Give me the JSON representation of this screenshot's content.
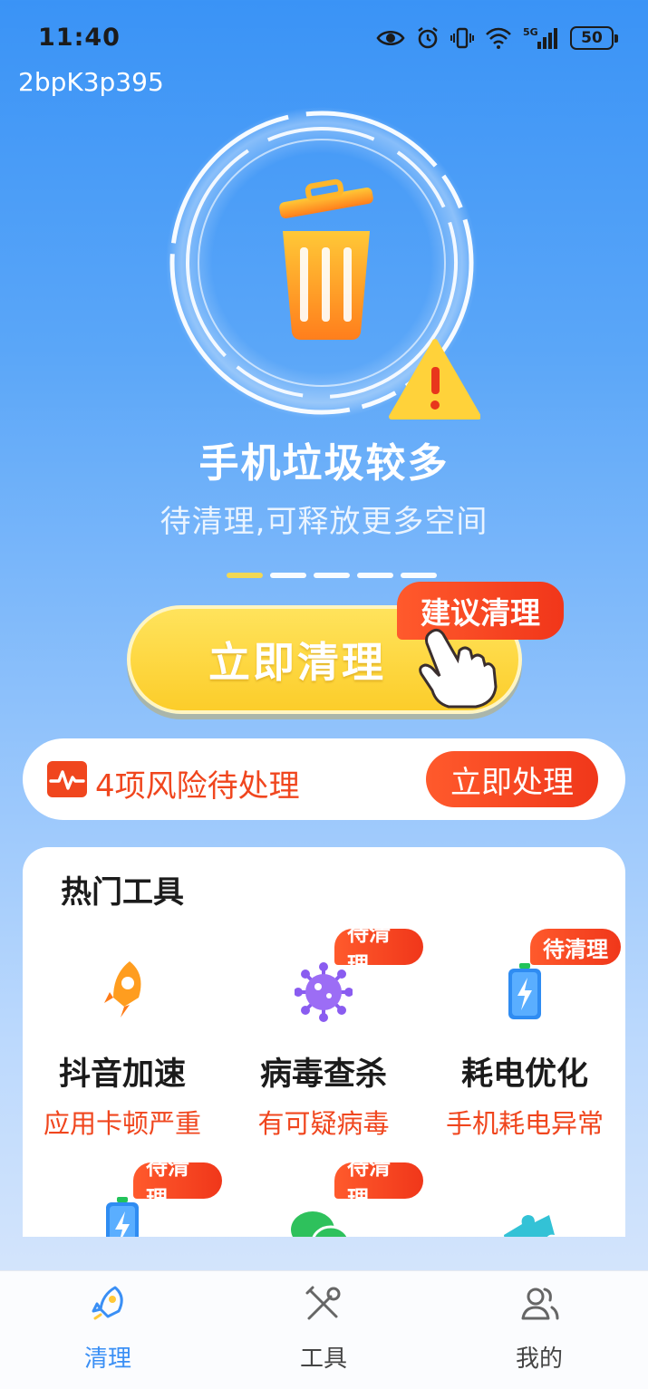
{
  "status_bar": {
    "time": "11:40",
    "battery": "50",
    "network": "5G"
  },
  "device_id": "2bpK3p395",
  "hero": {
    "headline": "手机垃圾较多",
    "subline": "待清理,可释放更多空间",
    "clean_button": "立即清理",
    "suggest_tag": "建议清理",
    "pager_count": 5,
    "pager_active": 0
  },
  "risk": {
    "text": "4项风险待处理",
    "button": "立即处理"
  },
  "tools": {
    "title": "热门工具",
    "items": [
      {
        "name": "抖音加速",
        "desc": "应用卡顿严重",
        "badge": "",
        "icon": "rocket-icon"
      },
      {
        "name": "病毒查杀",
        "desc": "有可疑病毒",
        "badge": "待清理",
        "icon": "virus-icon"
      },
      {
        "name": "耗电优化",
        "desc": "手机耗电异常",
        "badge": "待清理",
        "icon": "battery-icon"
      },
      {
        "name": "",
        "desc": "",
        "badge": "待清理",
        "icon": "battery-icon"
      },
      {
        "name": "",
        "desc": "",
        "badge": "待清理",
        "icon": "wechat-icon"
      },
      {
        "name": "",
        "desc": "",
        "badge": "",
        "icon": "puzzle-icon"
      }
    ]
  },
  "nav": {
    "items": [
      {
        "label": "清理",
        "icon": "rocket-icon",
        "active": true
      },
      {
        "label": "工具",
        "icon": "tools-icon",
        "active": false
      },
      {
        "label": "我的",
        "icon": "user-icon",
        "active": false
      }
    ]
  },
  "colors": {
    "accent": "#3a8ff5",
    "warning": "#f0461e",
    "button_yellow": "#fccd2a"
  }
}
